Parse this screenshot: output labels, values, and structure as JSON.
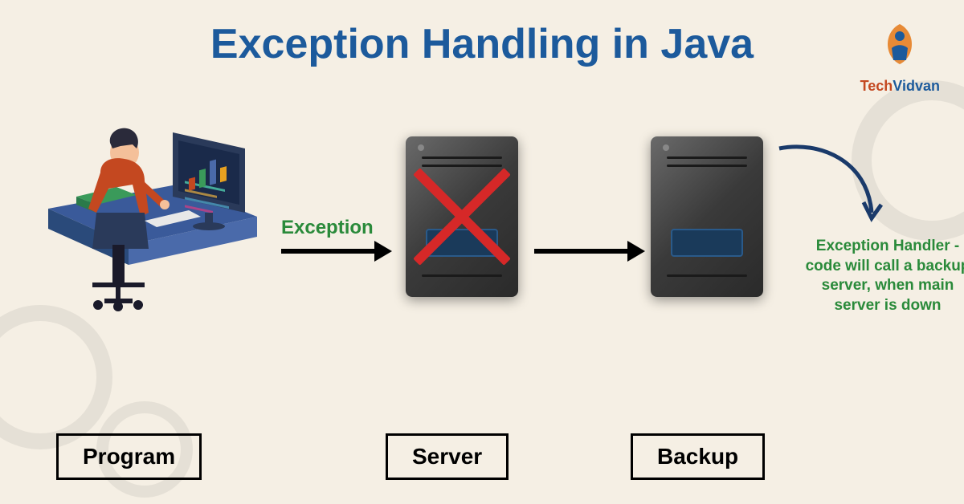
{
  "title": "Exception Handling in Java",
  "logo": {
    "tech": "Tech",
    "vidvan": "Vidvan"
  },
  "labels": {
    "exception": "Exception",
    "handler_text": "Exception Handler - code will call a backup server, when main server is down",
    "program": "Program",
    "server": "Server",
    "backup": "Backup"
  },
  "colors": {
    "title": "#1c5a9c",
    "green_text": "#2a8a3a",
    "cross": "#d62828",
    "background": "#f5efe4"
  }
}
